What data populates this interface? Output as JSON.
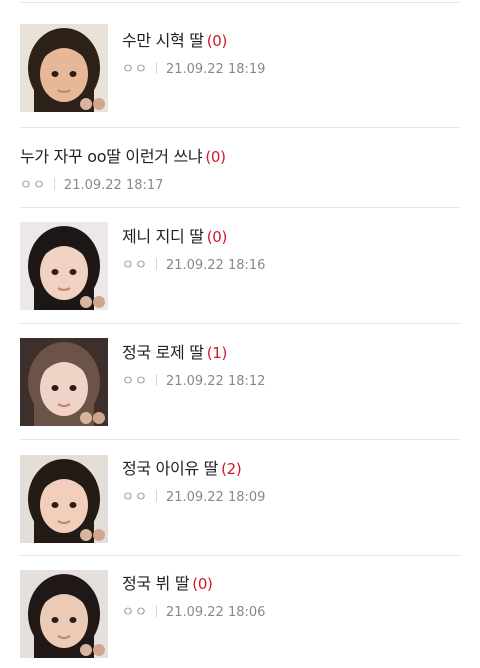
{
  "posts": [
    {
      "title": "수만 시혁 딸",
      "count": "(0)",
      "author": "ㅇㅇ",
      "date": "21.09.22 18:19",
      "thumbnail": true,
      "hair": "#2b2119",
      "skin": "#e6b897",
      "bg": "#e9e2d9"
    },
    {
      "title": "누가 자꾸 oo딸 이런거 쓰냐",
      "count": "(0)",
      "author": "ㅇㅇ",
      "date": "21.09.22 18:17",
      "thumbnail": false
    },
    {
      "title": "제니 지디 딸",
      "count": "(0)",
      "author": "ㅇㅇ",
      "date": "21.09.22 18:16",
      "thumbnail": true,
      "hair": "#1c1716",
      "skin": "#f0d2c2",
      "bg": "#ece8ea"
    },
    {
      "title": "정국 로제 딸",
      "count": "(1)",
      "author": "ㅇㅇ",
      "date": "21.09.22 18:12",
      "thumbnail": true,
      "hair": "#6b5347",
      "skin": "#efd3c6",
      "bg": "#3d2f2b"
    },
    {
      "title": "정국 아이유 딸",
      "count": "(2)",
      "author": "ㅇㅇ",
      "date": "21.09.22 18:09",
      "thumbnail": true,
      "hair": "#241a16",
      "skin": "#f2cfbb",
      "bg": "#e4ded9"
    },
    {
      "title": "정국 뷔 딸",
      "count": "(0)",
      "author": "ㅇㅇ",
      "date": "21.09.22 18:06",
      "thumbnail": true,
      "hair": "#1f1816",
      "skin": "#eccbb6",
      "bg": "#e5e0dc"
    }
  ],
  "colors": {
    "count": "#d0182c",
    "divider": "#e6e6e6",
    "meta": "#888888"
  }
}
